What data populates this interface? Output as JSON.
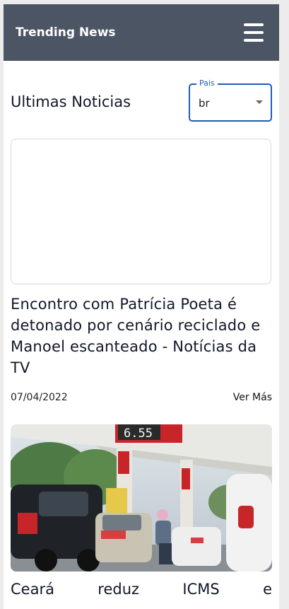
{
  "appbar": {
    "brand": "Trending News",
    "menu_icon": "hamburger-menu-icon"
  },
  "main": {
    "title": "Ultimas Noticias",
    "country_select": {
      "label": "Pais",
      "value": "br",
      "caret_icon": "dropdown-caret-icon"
    }
  },
  "articles": [
    {
      "title": "Encontro com Patrícia Poeta é detonado por cenário reciclado e Manoel escanteado - Notícias da TV",
      "date": "07/04/2022",
      "link": "Ver Más"
    },
    {
      "title": "Ceará reduz ICMS e",
      "photo": {
        "price_display": "6.55"
      }
    }
  ],
  "colors": {
    "appbar": "#4b5563",
    "accent": "#1e5bb8",
    "text": "#111827"
  }
}
